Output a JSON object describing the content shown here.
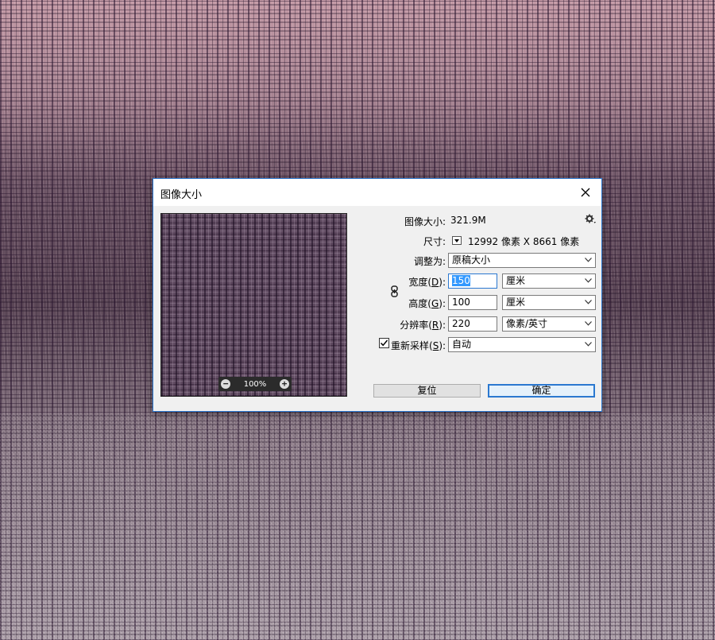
{
  "dialog": {
    "title": "图像大小",
    "close_glyph": "✕"
  },
  "preview": {
    "zoom_level": "100%",
    "zoom_out_glyph": "−",
    "zoom_in_glyph": "+"
  },
  "info": {
    "image_size_label": "图像大小:",
    "image_size_value": "321.9M",
    "dimensions_label": "尺寸:",
    "dimensions_value": "12992 像素  X  8661 像素"
  },
  "fields": {
    "fit_to_label": "调整为:",
    "fit_to_value": "原稿大小",
    "width_label_pre": "宽度(",
    "width_label_key": "D",
    "width_label_post": "):",
    "width_value": "150",
    "width_unit": "厘米",
    "height_label_pre": "高度(",
    "height_label_key": "G",
    "height_label_post": "):",
    "height_value": "100",
    "height_unit": "厘米",
    "resolution_label_pre": "分辨率(",
    "resolution_label_key": "R",
    "resolution_label_post": "):",
    "resolution_value": "220",
    "resolution_unit": "像素/英寸",
    "resample_checked": true,
    "resample_label_pre": "重新采样(",
    "resample_label_key": "S",
    "resample_label_post": "):",
    "resample_value": "自动"
  },
  "buttons": {
    "reset_label": "复位",
    "ok_label": "确定"
  },
  "icons": {
    "gear": "gear-icon",
    "link": "link-icon",
    "close": "close-icon",
    "dropdown": "chevron-down-icon",
    "checkmark": "checkmark-icon"
  },
  "colors": {
    "accent": "#2b78d0",
    "selection": "#3399ff",
    "dialog_bg": "#f0f0f0"
  }
}
